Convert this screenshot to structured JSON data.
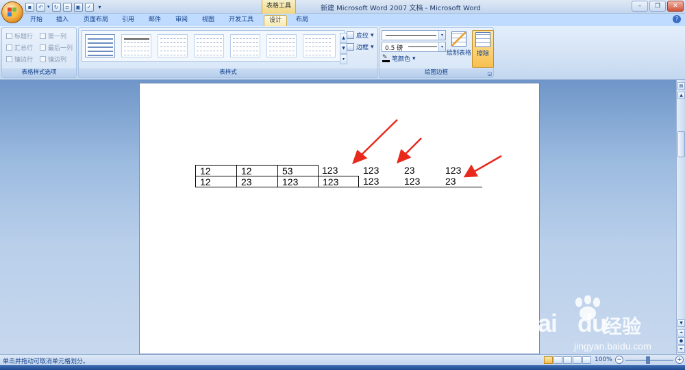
{
  "window": {
    "context_tab": "表格工具",
    "title": "新建 Microsoft Word 2007 文档 - Microsoft Word",
    "controls": [
      "–",
      "❐",
      "✕"
    ]
  },
  "quick_access": [
    "save-icon",
    "undo-icon",
    "redo-icon",
    "new-doc-icon",
    "print-preview-icon",
    "spelling-icon",
    "customize-icon"
  ],
  "tabs": [
    "开始",
    "插入",
    "页面布局",
    "引用",
    "邮件",
    "审阅",
    "视图",
    "开发工具",
    "设计",
    "布局"
  ],
  "active_tab": "设计",
  "ribbon": {
    "options_group": {
      "label": "表格样式选项",
      "checkboxes": [
        "标题行",
        "第一列",
        "汇总行",
        "最后一列",
        "镶边行",
        "镶边列"
      ]
    },
    "styles_group": {
      "label": "表样式",
      "shading_label": "底纹",
      "borders_label": "边框"
    },
    "draw_group": {
      "label": "绘图边框",
      "line_weight": "0.5 磅",
      "pen_color_label": "笔颜色",
      "draw_table_label": "绘制表格",
      "erase_label": "擦除"
    }
  },
  "table": {
    "row1": [
      "12",
      "12",
      "53",
      "123",
      "123",
      "23",
      "123"
    ],
    "row2": [
      "12",
      "23",
      "123",
      "123",
      "123",
      "123",
      "23"
    ]
  },
  "status": {
    "message": "单击并拖动可取消单元格划分。",
    "zoom": "100%"
  },
  "watermark": {
    "logo": "Bai",
    "logo_tail": "du",
    "cn": "经验",
    "url": "jingyan.baidu.com"
  },
  "colors": {
    "ribbon_bg": "#cfdff3",
    "active_tab": "#f7e9b0",
    "arrow": "#e8291c"
  }
}
